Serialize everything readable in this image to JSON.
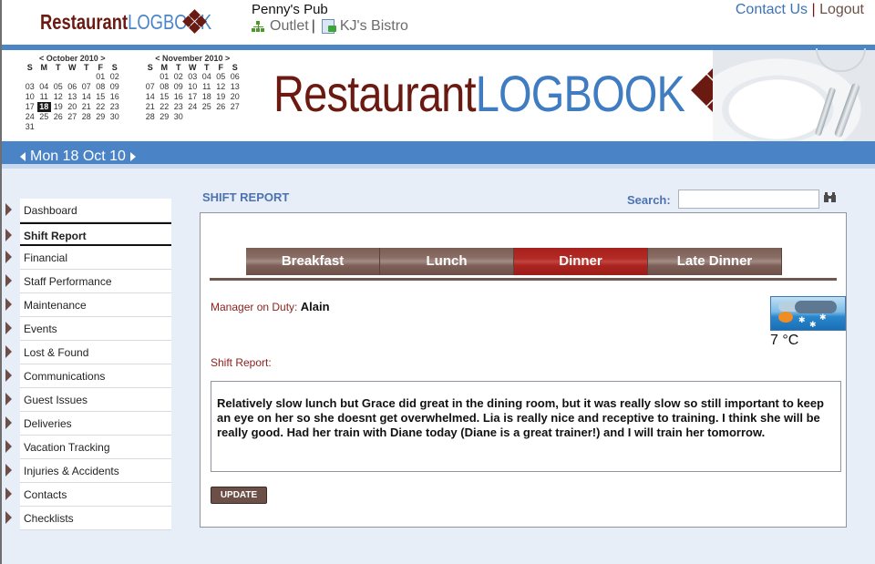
{
  "header": {
    "logo": {
      "part1": "Restaurant",
      "part2": "LOGBOOK"
    },
    "outlet_name": "Penny's Pub",
    "outlet_link": "Outlet",
    "separator": "|",
    "other_outlet": "KJ's Bistro",
    "contact_label": "Contact Us",
    "logout_label": "Logout"
  },
  "banner": {
    "logo": {
      "part1": "Restaurant",
      "part2": "LOGBOOK"
    }
  },
  "calendars": [
    {
      "title": "< October 2010 >",
      "weekdays": [
        "S",
        "M",
        "T",
        "W",
        "T",
        "F",
        "S"
      ],
      "weeks": [
        [
          "",
          "",
          "",
          "",
          "",
          "01",
          "02"
        ],
        [
          "03",
          "04",
          "05",
          "06",
          "07",
          "08",
          "09"
        ],
        [
          "10",
          "11",
          "12",
          "13",
          "14",
          "15",
          "16"
        ],
        [
          "17",
          "18",
          "19",
          "20",
          "21",
          "22",
          "23"
        ],
        [
          "24",
          "25",
          "26",
          "27",
          "28",
          "29",
          "30"
        ],
        [
          "31",
          "",
          "",
          "",
          "",
          "",
          ""
        ]
      ],
      "selected": "18"
    },
    {
      "title": "< November 2010 >",
      "weekdays": [
        "S",
        "M",
        "T",
        "W",
        "T",
        "F",
        "S"
      ],
      "weeks": [
        [
          "",
          "01",
          "02",
          "03",
          "04",
          "05",
          "06"
        ],
        [
          "07",
          "08",
          "09",
          "10",
          "11",
          "12",
          "13"
        ],
        [
          "14",
          "15",
          "16",
          "17",
          "18",
          "19",
          "20"
        ],
        [
          "21",
          "22",
          "23",
          "24",
          "25",
          "26",
          "27"
        ],
        [
          "28",
          "29",
          "30",
          "",
          "",
          "",
          ""
        ]
      ],
      "selected": ""
    }
  ],
  "datebar": {
    "date": "Mon 18 Oct 10"
  },
  "sidebar": {
    "items": [
      {
        "label": "Dashboard",
        "active": false
      },
      {
        "label": "Shift Report",
        "active": true
      },
      {
        "label": "Financial",
        "active": false
      },
      {
        "label": "Staff Performance",
        "active": false
      },
      {
        "label": "Maintenance",
        "active": false
      },
      {
        "label": "Events",
        "active": false
      },
      {
        "label": "Lost & Found",
        "active": false
      },
      {
        "label": "Communications",
        "active": false
      },
      {
        "label": "Guest Issues",
        "active": false
      },
      {
        "label": "Deliveries",
        "active": false
      },
      {
        "label": "Vacation Tracking",
        "active": false
      },
      {
        "label": "Injuries & Accidents",
        "active": false
      },
      {
        "label": "Contacts",
        "active": false
      },
      {
        "label": "Checklists",
        "active": false
      }
    ]
  },
  "main": {
    "title": "SHIFT REPORT",
    "search_label": "Search:",
    "search_value": "",
    "tabs": [
      {
        "label": "Breakfast",
        "active": false
      },
      {
        "label": "Lunch",
        "active": false
      },
      {
        "label": "Dinner",
        "active": true
      },
      {
        "label": "Late Dinner",
        "active": false
      }
    ],
    "manager_label": "Manager on Duty:",
    "manager_name": "Alain",
    "weather": {
      "icon": "snow-cloud-sun-icon",
      "temperature": "7 °C"
    },
    "shift_report_label": "Shift Report:",
    "shift_report_text": "Relatively slow lunch but Grace did great in the dining room, but it was really slow so still important to keep an eye on her so she doesnt get overwhelmed. Lia is really nice and receptive to training. I think she will be really good. Had her train with Diane today (Diane is a great trainer!) and I will train her tomorrow.",
    "update_label": "UPDATE"
  },
  "colors": {
    "brand_red": "#6b1a12",
    "brand_blue": "#4a86c6",
    "tab_active": "#b52a24",
    "tab_inactive": "#7a5e56",
    "label_red": "#8b1f1b"
  }
}
